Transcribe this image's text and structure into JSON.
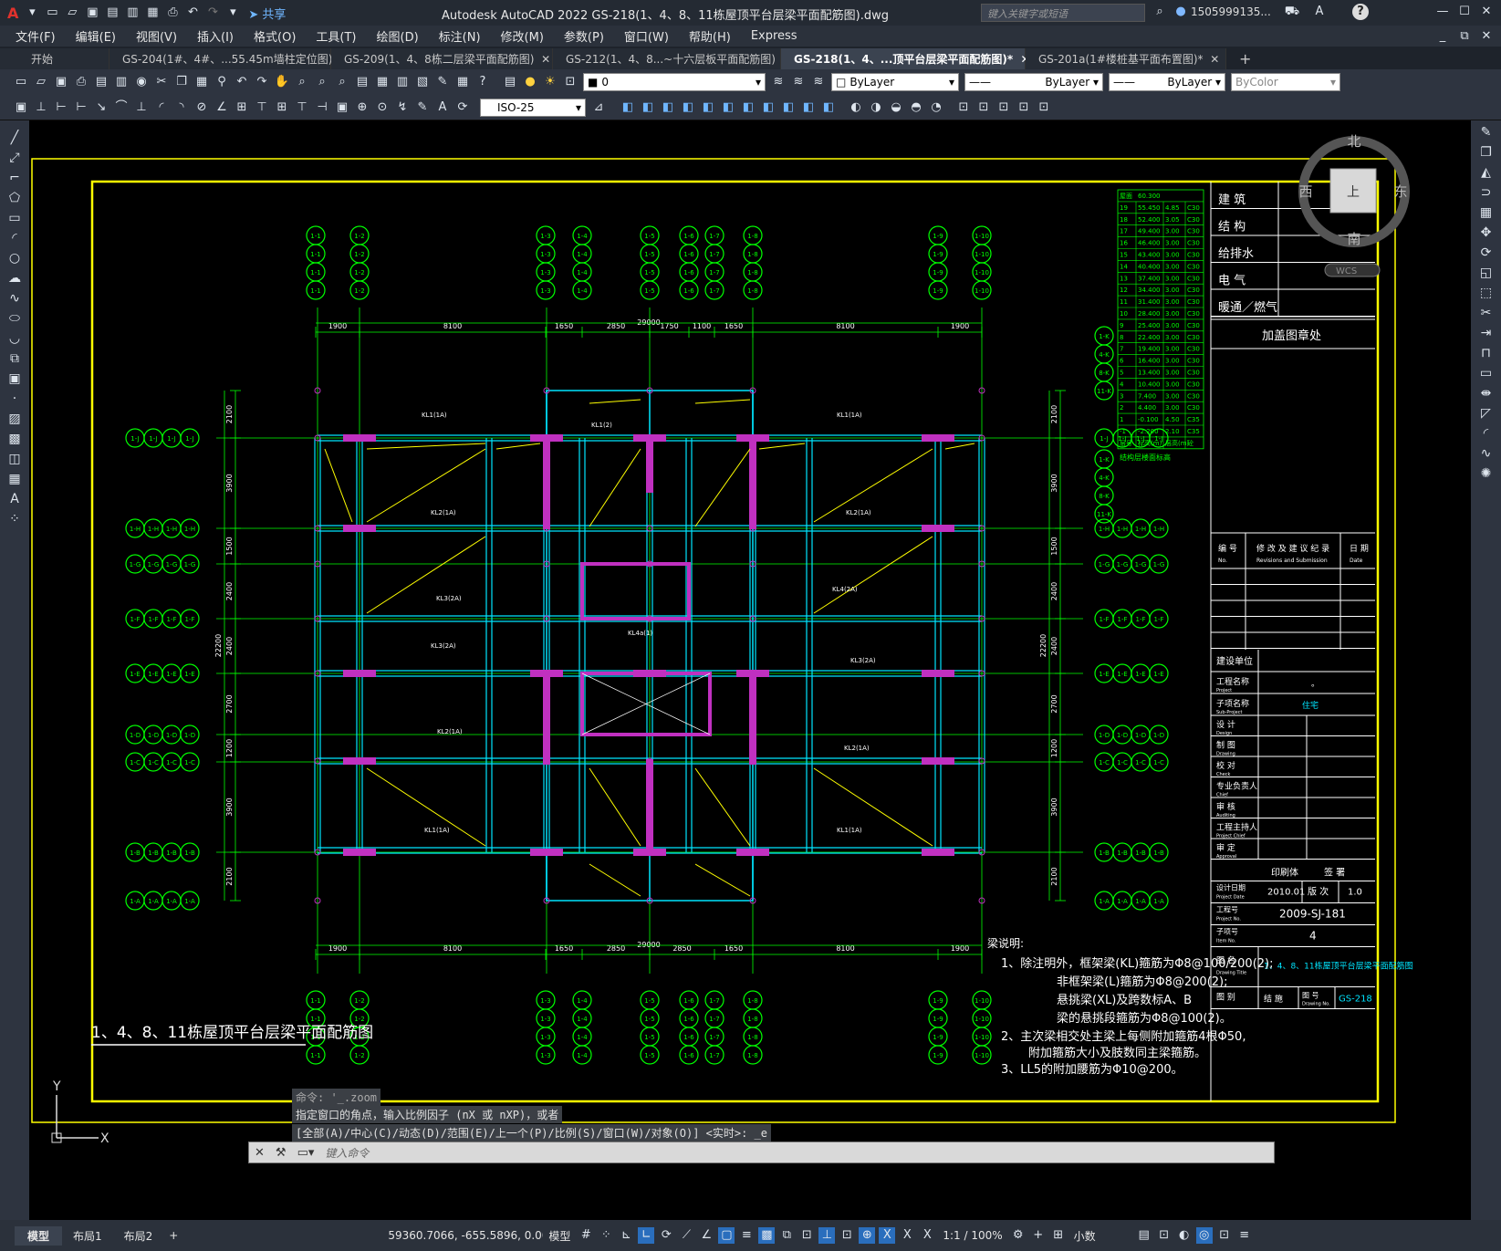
{
  "app": {
    "title": "Autodesk AutoCAD 2022    GS-218(1、4、8、11栋屋顶平台层梁平面配筋图).dwg",
    "share": "共享",
    "search_placeholder": "键入关键字或短语",
    "user": "1505999135...",
    "app_icon": "A"
  },
  "menu": [
    "文件(F)",
    "编辑(E)",
    "视图(V)",
    "插入(I)",
    "格式(O)",
    "工具(T)",
    "绘图(D)",
    "标注(N)",
    "修改(M)",
    "参数(P)",
    "窗口(W)",
    "帮助(H)",
    "Express"
  ],
  "tabs": [
    {
      "label": "开始",
      "active": false
    },
    {
      "label": "GS-204(1#、4#、...55.45m墙柱定位图)",
      "active": false
    },
    {
      "label": "GS-209(1、4、8栋二层梁平面配筋图)",
      "active": false
    },
    {
      "label": "GS-212(1、4、8...~十六层板平面配筋图)",
      "active": false
    },
    {
      "label": "GS-218(1、4、...顶平台层梁平面配筋图)*",
      "active": true
    },
    {
      "label": "GS-201a(1#楼桩基平面布置图)*",
      "active": false
    }
  ],
  "toolbar": {
    "layer": "0",
    "linetype1": "ByLayer",
    "linetype2": "ByLayer",
    "lineweight": "ByLayer",
    "color": "ByColor",
    "dimstyle": "ISO-25"
  },
  "viewcube": {
    "north": "北",
    "south": "南",
    "east": "东",
    "west": "西",
    "top": "上",
    "wcs": "WCS"
  },
  "drawing": {
    "title": "1、4、8、11栋屋顶平台层梁平面配筋图",
    "dims_top": [
      "1900",
      "8100",
      "1650",
      "2850",
      "1750",
      "1100",
      "1650",
      "8100",
      "1900"
    ],
    "dims_bottom": [
      "1900",
      "8100",
      "1650",
      "2850",
      "2850",
      "1650",
      "8100",
      "1900"
    ],
    "total_width": "29000",
    "dims_left": [
      "2100",
      "3900",
      "1500",
      "2400",
      "2400",
      "2700",
      "1200",
      "3900",
      "2100"
    ],
    "total_height": "22200",
    "axis_rows": [
      "1-J",
      "1-H",
      "1-G",
      "1-F",
      "1-E",
      "1-D",
      "1-C",
      "1-B",
      "1-A"
    ],
    "axis_rows_right": [
      "1-K",
      "4-K",
      "8-K",
      "11-K"
    ],
    "axis_cols_left": [
      "1-1",
      "1-2"
    ],
    "axis_cols_mid": [
      "1-3",
      "1-4",
      "1-5",
      "1-6",
      "1-7",
      "1-8"
    ],
    "axis_cols_right": [
      "1-9",
      "1-10"
    ],
    "notes_title": "梁说明:",
    "notes": [
      "1、除注明外，框架梁(KL)箍筋为Φ8@100/200(2);",
      "非框架梁(L)箍筋为Φ8@200(2);",
      "悬挑梁(XL)及跨数标A、B",
      "梁的悬挑段箍筋为Φ8@100(2)。",
      "2、主次梁相交处主梁上每侧附加箍筋4根Φ50,",
      "附加箍筋大小及肢数同主梁箍筋。",
      "3、LL5的附加腰筋为Φ10@200。"
    ]
  },
  "level_table": {
    "header": [
      "屋面",
      "60.300"
    ],
    "rows": [
      [
        "19",
        "55.450",
        "4.85",
        "C30"
      ],
      [
        "18",
        "52.400",
        "3.05",
        "C30"
      ],
      [
        "17",
        "49.400",
        "3.00",
        "C30"
      ],
      [
        "16",
        "46.400",
        "3.00",
        "C30"
      ],
      [
        "15",
        "43.400",
        "3.00",
        "C30"
      ],
      [
        "14",
        "40.400",
        "3.00",
        "C30"
      ],
      [
        "13",
        "37.400",
        "3.00",
        "C30"
      ],
      [
        "12",
        "34.400",
        "3.00",
        "C30"
      ],
      [
        "11",
        "31.400",
        "3.00",
        "C30"
      ],
      [
        "10",
        "28.400",
        "3.00",
        "C30"
      ],
      [
        "9",
        "25.400",
        "3.00",
        "C30"
      ],
      [
        "8",
        "22.400",
        "3.00",
        "C30"
      ],
      [
        "7",
        "19.400",
        "3.00",
        "C30"
      ],
      [
        "6",
        "16.400",
        "3.00",
        "C30"
      ],
      [
        "5",
        "13.400",
        "3.00",
        "C30"
      ],
      [
        "4",
        "10.400",
        "3.00",
        "C30"
      ],
      [
        "3",
        "7.400",
        "3.00",
        "C30"
      ],
      [
        "2",
        "4.400",
        "3.00",
        "C30"
      ],
      [
        "1",
        "-0.100",
        "4.50",
        "C35"
      ],
      [
        "-1",
        "-2.200",
        "2.10",
        "C35"
      ]
    ],
    "foot": [
      "层号",
      "标高(m)",
      "层高(m)",
      "砼"
    ],
    "note": "结构层楼面标高"
  },
  "titleblock": {
    "disciplines": [
      "建  筑",
      "结  构",
      "给排水",
      "电  气",
      "暖通／燃气"
    ],
    "stamp": "加盖图章处",
    "revision_header": [
      "编 号",
      "修 改 及 建 议 纪 录",
      "日 期"
    ],
    "revision_sub": [
      "No.",
      "Revisions and Submission",
      "Date"
    ],
    "client": "建设单位",
    "project": "工程名称",
    "project_en": "Project",
    "project_val": "。",
    "subproject": "子项名称",
    "subproject_en": "Sub-Project",
    "subproject_val": "住宅",
    "roles": [
      [
        "设  计",
        "Design"
      ],
      [
        "制  图",
        "Drawing"
      ],
      [
        "校  对",
        "Check"
      ],
      [
        "专业负责人",
        "Chief"
      ],
      [
        "审  核",
        "Auditing"
      ],
      [
        "工程主持人",
        "Project Chief"
      ],
      [
        "审  定",
        "Approval"
      ]
    ],
    "seal": "印刷体",
    "sign": "签 署",
    "date_label": "设计日期",
    "date_en": "Project Date",
    "date": "2010.01",
    "version_label": "版 次",
    "version": "1.0",
    "projno_label": "工程号",
    "projno_en": "Project No.",
    "projno": "2009-SJ-181",
    "item_label": "子项号",
    "item_en": "Item No.",
    "item": "4",
    "dwgname_label": "图  名",
    "dwgname_en": "Drawing Title",
    "dwgname": "1、4、8、11栋屋顶平台层梁平面配筋图",
    "cat_label": "图  别",
    "cat": "结 施",
    "dwgno_label": "图 号",
    "dwgno_en": "Drawing No.",
    "dwgno": "GS-218"
  },
  "command": {
    "line1": "命令: '_.zoom",
    "line2": "指定窗口的角点，输入比例因子 (nX 或 nXP)，或者",
    "line3": "[全部(A)/中心(C)/动态(D)/范围(E)/上一个(P)/比例(S)/窗口(W)/对象(O)] <实时>: _e",
    "placeholder": "键入命令"
  },
  "ucs": {
    "x": "X",
    "y": "Y"
  },
  "status": {
    "tabs": [
      "模型",
      "布局1",
      "布局2"
    ],
    "coords": "59360.7066, -655.5896, 0.00...",
    "model": "模型",
    "scale": "1:1 / 100%",
    "units": "小数"
  }
}
